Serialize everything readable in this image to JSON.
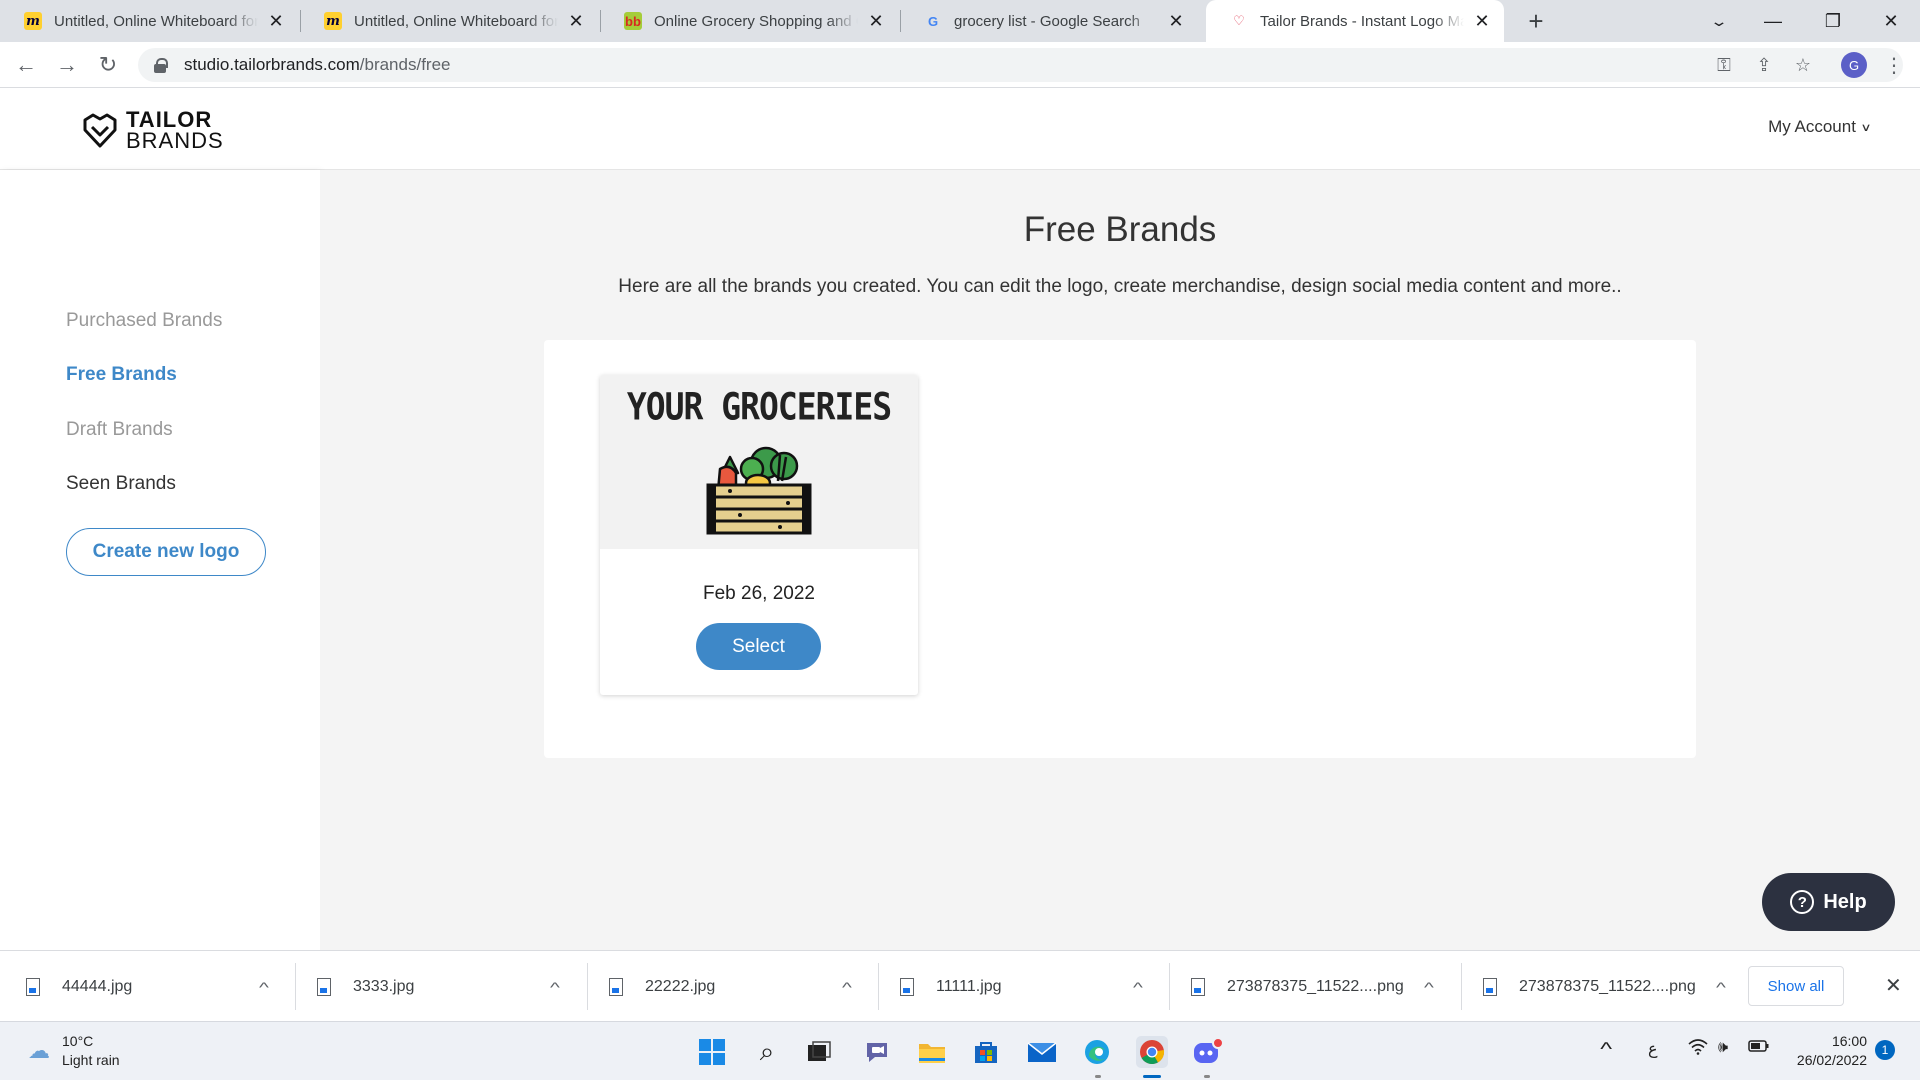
{
  "browser": {
    "tabs": [
      {
        "title": "Untitled, Online Whiteboard for Visual Collaboration",
        "favicon": "miro-icon",
        "active": false
      },
      {
        "title": "Untitled, Online Whiteboard for Visual Collaboration",
        "favicon": "miro-icon",
        "active": false
      },
      {
        "title": "Online Grocery Shopping and Online Supermarket",
        "favicon": "bigbasket-icon",
        "active": false
      },
      {
        "title": "grocery list - Google Search",
        "favicon": "google-icon",
        "active": false
      },
      {
        "title": "Tailor Brands - Instant Logo Maker",
        "favicon": "tailorbrands-icon",
        "active": true
      }
    ],
    "url_host": "studio.tailorbrands.com",
    "url_path": "/brands/free",
    "profile_initial": "G"
  },
  "header": {
    "logo_line1": "TAILOR",
    "logo_line2": "BRANDS",
    "account_label": "My Account"
  },
  "sidebar": {
    "items": [
      {
        "label": "Purchased Brands",
        "state": "muted"
      },
      {
        "label": "Free Brands",
        "state": "active"
      },
      {
        "label": "Draft Brands",
        "state": "muted"
      },
      {
        "label": "Seen Brands",
        "state": "normal"
      }
    ],
    "create_label": "Create new logo"
  },
  "main": {
    "title": "Free Brands",
    "subtitle": "Here are all the brands you created. You can edit the logo, create merchandise, design social media content and more..",
    "brands": [
      {
        "name": "YOUR GROCERIES",
        "date": "Feb 26, 2022",
        "select_label": "Select"
      }
    ],
    "help_label": "Help"
  },
  "downloads": {
    "items": [
      {
        "name": "44444.jpg"
      },
      {
        "name": "3333.jpg"
      },
      {
        "name": "22222.jpg"
      },
      {
        "name": "11111.jpg"
      },
      {
        "name": "273878375_11522....png"
      },
      {
        "name": "273878375_11522....png"
      }
    ],
    "show_all_label": "Show all"
  },
  "taskbar": {
    "temperature": "10°C",
    "weather": "Light rain",
    "time": "16:00",
    "date": "26/02/2022",
    "notification_count": "1",
    "lang": "ع"
  },
  "colors": {
    "accent": "#3e88c8",
    "help_bg": "#2c3140",
    "main_bg": "#f4f4f4"
  }
}
